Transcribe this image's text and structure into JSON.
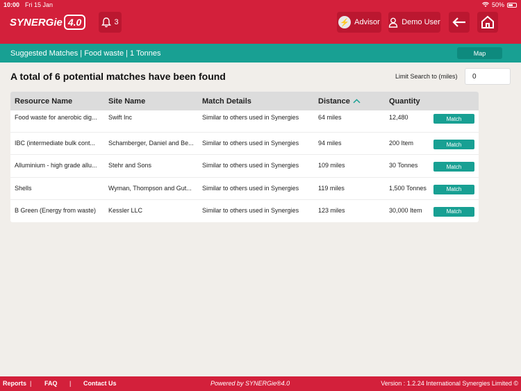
{
  "status": {
    "time": "10:00",
    "date": "Fri 15 Jan",
    "battery": "50%"
  },
  "header": {
    "logo_text": "SYNERGie",
    "logo_version": "4.0",
    "notification_count": "3",
    "advisor_label": "Advisor",
    "user_label": "Demo User"
  },
  "subheader": {
    "breadcrumb": "Suggested Matches  | Food waste | 1 Tonnes",
    "map_label": "Map"
  },
  "summary": "A total of 6 potential matches have been found",
  "limit": {
    "label": "Limit Search to (miles)",
    "value": "0"
  },
  "table": {
    "headers": {
      "resource": "Resource Name",
      "site": "Site Name",
      "details": "Match Details",
      "distance": "Distance",
      "quantity": "Quantity"
    },
    "match_label": "Match",
    "rows": [
      {
        "resource": "Food waste for anerobic dig...",
        "site": "Swift Inc",
        "details": "Similar to others used in Synergies",
        "distance": "64 miles",
        "quantity": "12,480"
      },
      {
        "resource": "IBC (intermediate bulk cont...",
        "site": "Schamberger, Daniel and Be...",
        "details": "Similar to others used in Synergies",
        "distance": "94 miles",
        "quantity": "200 Item"
      },
      {
        "resource": "Alluminium - high grade allu...",
        "site": "Stehr and Sons",
        "details": "Similar to others used in Synergies",
        "distance": "109 miles",
        "quantity": "30 Tonnes"
      },
      {
        "resource": "Shells",
        "site": "Wyman, Thompson and Gut...",
        "details": "Similar to others used in Synergies",
        "distance": "119 miles",
        "quantity": "1,500 Tonnes"
      },
      {
        "resource": "B Green (Energy from waste)",
        "site": "Kessler LLC",
        "details": "Similar to others used in Synergies",
        "distance": "123 miles",
        "quantity": "30,000 Item"
      }
    ]
  },
  "footer": {
    "reports": "Reports",
    "separator": "|",
    "faq": "FAQ",
    "contact": "Contact Us",
    "powered": "Powered by SYNERGie®4.0",
    "version": "Version : 1.2.24  International Synergies Limited ©"
  },
  "colors": {
    "brand_red": "#d3203b",
    "teal": "#18a093"
  }
}
